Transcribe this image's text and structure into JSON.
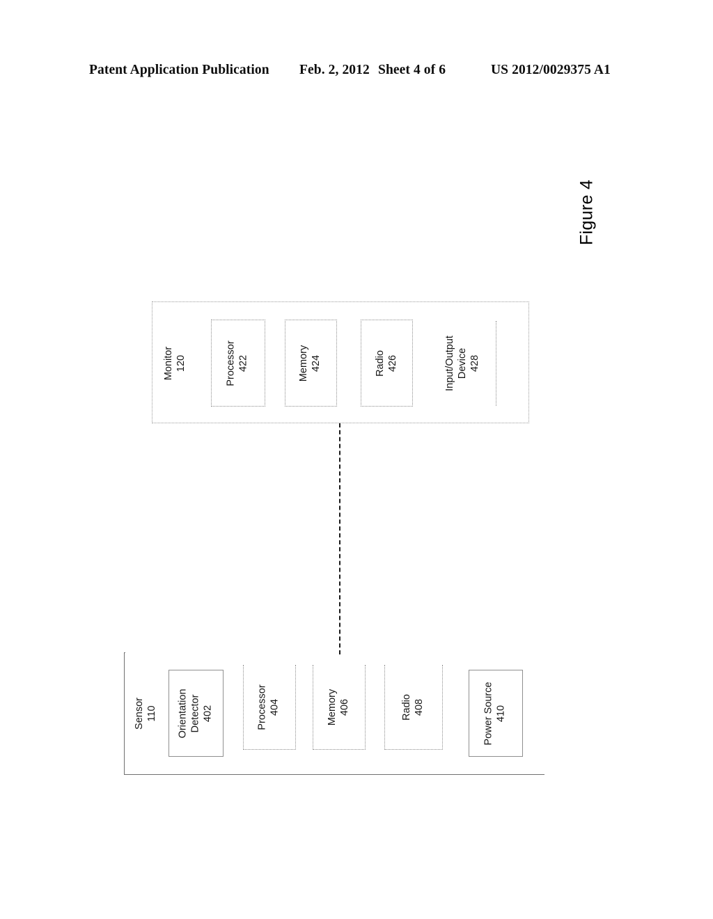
{
  "header": {
    "publication": "Patent Application Publication",
    "date": "Feb. 2, 2012",
    "sheet": "Sheet 4 of 6",
    "publication_number": "US 2012/0029375 A1"
  },
  "figure": {
    "caption": "Figure 4",
    "orientation": "landscape-rotated-90"
  },
  "diagram": {
    "blocks": [
      {
        "id": "monitor",
        "label": "Monitor",
        "ref": "120",
        "border": "dotted",
        "children": [
          {
            "id": "monitor-processor",
            "label": "Processor",
            "ref": "422",
            "border": "dotted"
          },
          {
            "id": "monitor-memory",
            "label": "Memory",
            "ref": "424",
            "border": "dotted"
          },
          {
            "id": "monitor-radio",
            "label": "Radio",
            "ref": "426",
            "border": "dotted"
          },
          {
            "id": "monitor-io-device",
            "label_line1": "Input/Output",
            "label_line2": "Device",
            "ref": "428",
            "border": "partial-rule"
          }
        ]
      },
      {
        "id": "sensor",
        "label": "Sensor",
        "ref": "110",
        "border": "solid-open",
        "children": [
          {
            "id": "sensor-orientation-detector",
            "label_line1": "Orientation",
            "label_line2": "Detector",
            "ref": "402",
            "border": "solid"
          },
          {
            "id": "sensor-processor",
            "label": "Processor",
            "ref": "404",
            "border": "dotted-no-top"
          },
          {
            "id": "sensor-memory",
            "label": "Memory",
            "ref": "406",
            "border": "dotted-no-top"
          },
          {
            "id": "sensor-radio",
            "label": "Radio",
            "ref": "408",
            "border": "dotted-no-top"
          },
          {
            "id": "sensor-power-source",
            "label_line1": "Power Source",
            "ref": "410",
            "border": "solid"
          }
        ]
      }
    ],
    "connector": {
      "id": "sensor-monitor-link",
      "style": "dashed",
      "from": "sensor",
      "to": "monitor"
    }
  },
  "colors": {
    "ink": "#000000",
    "dotted_border": "#8c8c8c",
    "solid_border": "#6f6f6f",
    "page_background": "#ffffff"
  }
}
